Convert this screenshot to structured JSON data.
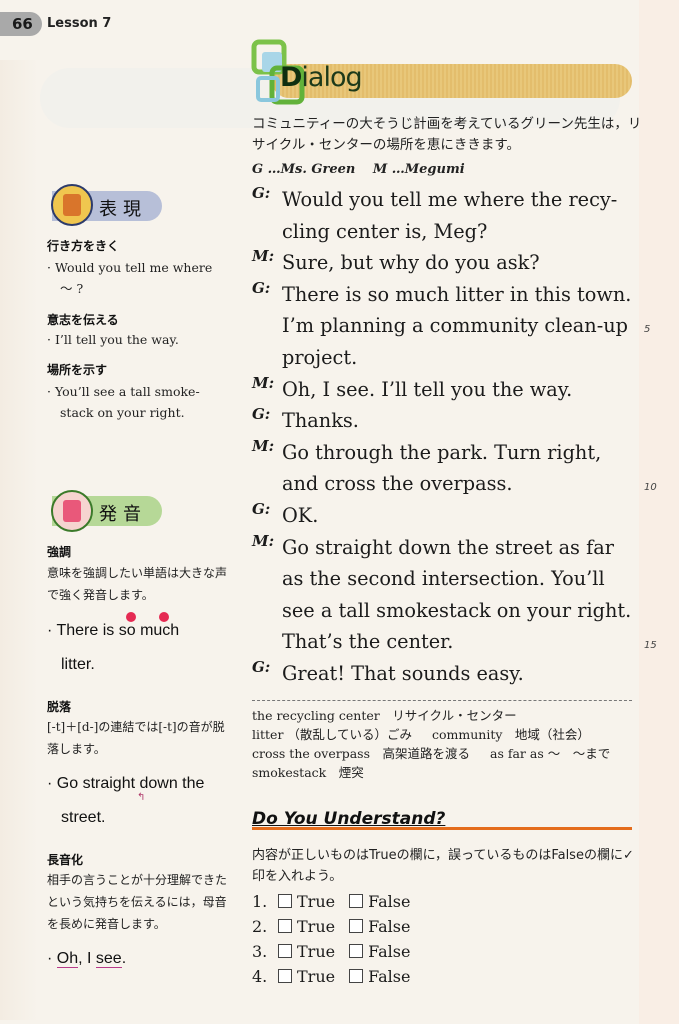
{
  "header": {
    "page_number": "66",
    "lesson": "Lesson 7"
  },
  "dialog": {
    "title_initial": "D",
    "title_rest": "ialog",
    "intro": "コミュニティーの大そうじ計画を考えているグリーン先生は，リサイクル・センターの場所を恵にききます。",
    "cast": "G …Ms. Green　 M …Megumi",
    "lines": [
      {
        "speaker": "G:",
        "text": "Would you tell me where the recy-"
      },
      {
        "speaker": "",
        "text": "cling center is, Meg?"
      },
      {
        "speaker": "M:",
        "text": "Sure, but why do you ask?"
      },
      {
        "speaker": "G:",
        "text": "There is so much litter in this town."
      },
      {
        "speaker": "",
        "text": "I’m planning a community clean-up"
      },
      {
        "speaker": "",
        "text": "project."
      },
      {
        "speaker": "M:",
        "text": "Oh, I see.  I’ll tell you the way."
      },
      {
        "speaker": "G:",
        "text": "Thanks."
      },
      {
        "speaker": "M:",
        "text": "Go through the park.  Turn right,"
      },
      {
        "speaker": "",
        "text": "and cross the overpass."
      },
      {
        "speaker": "G:",
        "text": "OK."
      },
      {
        "speaker": "M:",
        "text": "Go straight down the street as far"
      },
      {
        "speaker": "",
        "text": "as the second intersection.  You’ll"
      },
      {
        "speaker": "",
        "text": "see a tall smokestack on your right."
      },
      {
        "speaker": "",
        "text": "That’s the center."
      },
      {
        "speaker": "G:",
        "text": "Great!  That sounds easy."
      }
    ],
    "line_numbers": [
      "5",
      "10",
      "15"
    ]
  },
  "vocab": [
    "the recycling center　リサイクル・センター",
    "litter （散乱している）ごみ",
    "community　地域（社会）",
    "cross the overpass　高架道路を渡る",
    "as far as ～　～まで",
    "smokestack　煙突"
  ],
  "quiz": {
    "title": "Do You Understand?",
    "instruction": "内容が正しいものはTrueの欄に，誤っているものはFalseの欄に✓印を入れよう。",
    "items": [
      {
        "num": "1.",
        "true_label": "True",
        "false_label": "False",
        "answer": null
      },
      {
        "num": "2.",
        "true_label": "True",
        "false_label": "False",
        "answer": null
      },
      {
        "num": "3.",
        "true_label": "True",
        "false_label": "False",
        "answer": null
      },
      {
        "num": "4.",
        "true_label": "True",
        "false_label": "False",
        "answer": null
      }
    ]
  },
  "expression": {
    "badge": "表現",
    "icon": "robot-icon",
    "sections": [
      {
        "heading": "行き方をきく",
        "example": "· Would you tell me where",
        "example2": "～ ?"
      },
      {
        "heading": "意志を伝える",
        "example": "· I’ll tell you the way.",
        "example2": ""
      },
      {
        "heading": "場所を示す",
        "example": "· You’ll see a tall smoke-",
        "example2": "stack on your right."
      }
    ]
  },
  "pronunciation": {
    "badge": "発音",
    "icon": "robot-megaphone-icon",
    "sections": [
      {
        "heading": "強調",
        "text": "意味を強調したい単語は大きな声で強く発音します。",
        "example": "There is so much",
        "example2": "litter."
      },
      {
        "heading": "脱落",
        "text": "[-t]＋[d-]の連結では[-t]の音が脱落します。",
        "example": "Go straight down the",
        "example2": "street."
      },
      {
        "heading": "長音化",
        "text": "相手の言うことが十分理解できたという気持ちを伝えるには，母音を長めに発音します。",
        "example_a": "Oh",
        "example_b": ", I ",
        "example_c": "see",
        "example_d": "."
      }
    ]
  },
  "colors": {
    "accent_orange": "#e46c1c",
    "stress_dot": "#e52a52",
    "dialog_bar": "#e6c274"
  }
}
